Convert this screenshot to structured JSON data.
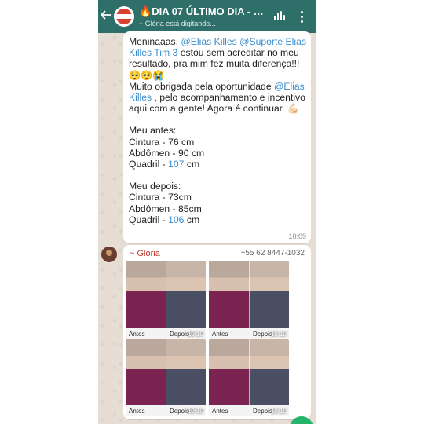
{
  "header": {
    "title_prefix": "🔥",
    "title": "DIA 07 ÚLTIMO DIA - Gr...",
    "subtitle": "~ Glória está digitando...",
    "colors": {
      "bar": "#2f6f69"
    },
    "icons": [
      "back-arrow-icon",
      "group-avatar",
      "audio-wave-icon",
      "more-vert-icon"
    ]
  },
  "message1": {
    "line1_prefix": "Meninaaas, ",
    "mention1": "@Elias Killes",
    "mention2": "@Suporte Elias Killes Tim 3",
    "line1_suffix": " estou sem acreditar no meu resultado, pra mim fez muita diferença!!! 🥺🥺😭",
    "line2_prefix": "Muito obrigada pela oportunidade ",
    "mention3": "@Elias Killes",
    "line2_suffix": " , pelo acompanhamento e incentivo aqui com a gente! Agora é continuar. 💪🏻",
    "before_title": "Meu antes:",
    "before_cintura": "Cintura - 76 cm",
    "before_abdomen": "Abdômen - 90 cm",
    "before_quadril_label": "Quadril - ",
    "before_quadril_value": "107",
    "before_quadril_unit": " cm",
    "after_title": "Meu depois:",
    "after_cintura": "Cintura - 73cm",
    "after_abdomen": "Abdômen - 85cm",
    "after_quadril_label": "Quadril - ",
    "after_quadril_value": "106",
    "after_quadril_unit": " cm",
    "time": "10:09"
  },
  "message2": {
    "sender": "~ Glória",
    "phone": "+55 62 8447-1032",
    "photos": [
      {
        "antes": "Antes",
        "depois": "Depois",
        "time": "10:10"
      },
      {
        "antes": "Antes",
        "depois": "Depois",
        "time": "10:10"
      },
      {
        "antes": "Antes",
        "depois": "Depois",
        "time": "10:10"
      },
      {
        "antes": "Antes",
        "depois": "Depois",
        "time": "10:10"
      }
    ]
  }
}
